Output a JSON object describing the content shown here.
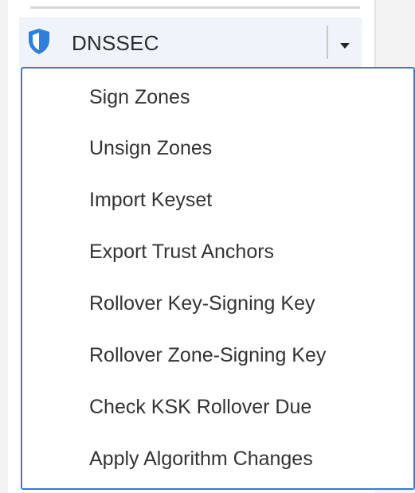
{
  "dnssec_button": {
    "label": "DNSSEC",
    "icon": "shield-icon",
    "icon_color": "#2f7fd8"
  },
  "menu": {
    "border_color": "#2e7fd6",
    "items": [
      {
        "label": "Sign Zones"
      },
      {
        "label": "Unsign Zones"
      },
      {
        "label": "Import Keyset"
      },
      {
        "label": "Export Trust Anchors"
      },
      {
        "label": "Rollover Key-Signing Key"
      },
      {
        "label": "Rollover Zone-Signing Key"
      },
      {
        "label": "Check KSK Rollover Due"
      },
      {
        "label": "Apply Algorithm Changes"
      }
    ]
  }
}
